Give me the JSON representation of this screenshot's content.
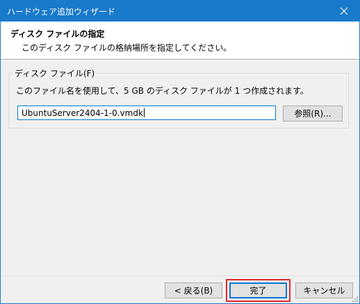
{
  "window": {
    "title": "ハードウェア追加ウィザード"
  },
  "header": {
    "title": "ディスク ファイルの指定",
    "subtitle": "このディスク ファイルの格納場所を指定してください。"
  },
  "group": {
    "legend": "ディスク ファイル(F)",
    "description": "このファイル名を使用して、5 GB のディスク ファイルが 1 つ作成されます。",
    "file_name": "UbuntuServer2404-1-0.vmdk",
    "browse_label": "参照(R)..."
  },
  "footer": {
    "back_label": "< 戻る(B)",
    "finish_label": "完了",
    "cancel_label": "キャンセル"
  },
  "colors": {
    "titlebar": "#1979ca",
    "focus_border": "#0078d7",
    "highlight_box": "#e0262c"
  },
  "icons": [
    "close-icon",
    "resize-grip-icon"
  ]
}
